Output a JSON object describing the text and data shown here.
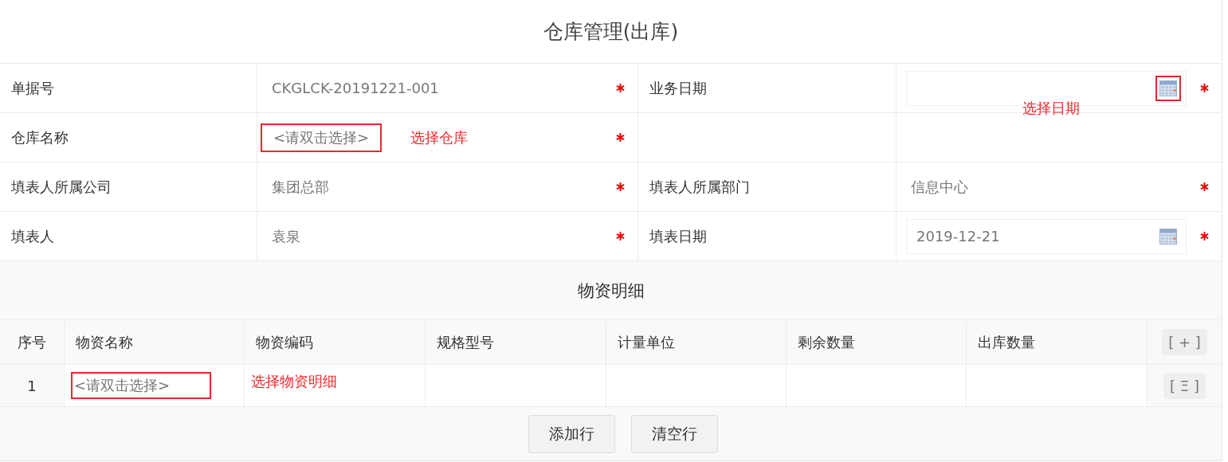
{
  "title": "仓库管理(出库)",
  "form_rows": [
    {
      "left": {
        "label": "单据号",
        "kind": "text",
        "value": "CKGLCK-20191221-001",
        "required": true
      },
      "right": {
        "label": "业务日期",
        "kind": "date",
        "highlighted": true,
        "note": "选择日期",
        "required": true
      }
    },
    {
      "left": {
        "label": "仓库名称",
        "kind": "picker",
        "placeholder": "<请双击选择>",
        "highlighted": true,
        "note": "选择仓库",
        "required": true
      }
    },
    {
      "left": {
        "label": "填表人所属公司",
        "kind": "text",
        "value": "集团总部",
        "required": true
      },
      "right": {
        "label": "填表人所属部门",
        "kind": "text",
        "value": "信息中心",
        "required": true
      }
    },
    {
      "left": {
        "label": "填表人",
        "kind": "text",
        "value": "袁泉",
        "required": true
      },
      "right": {
        "label": "填表日期",
        "kind": "date",
        "value": "2019-12-21",
        "highlighted": false,
        "required": true
      }
    }
  ],
  "detail": {
    "title": "物资明细",
    "columns": [
      "序号",
      "物资名称",
      "物资编码",
      "规格型号",
      "计量单位",
      "剩余数量",
      "出库数量"
    ],
    "header_action": "[ + ]",
    "rows": [
      {
        "index": "1",
        "placeholder": "<请双击选择>",
        "highlighted": true,
        "note": "选择物资明细",
        "action": "[ Ξ ]"
      }
    ],
    "buttons": [
      "添加行",
      "清空行"
    ]
  }
}
